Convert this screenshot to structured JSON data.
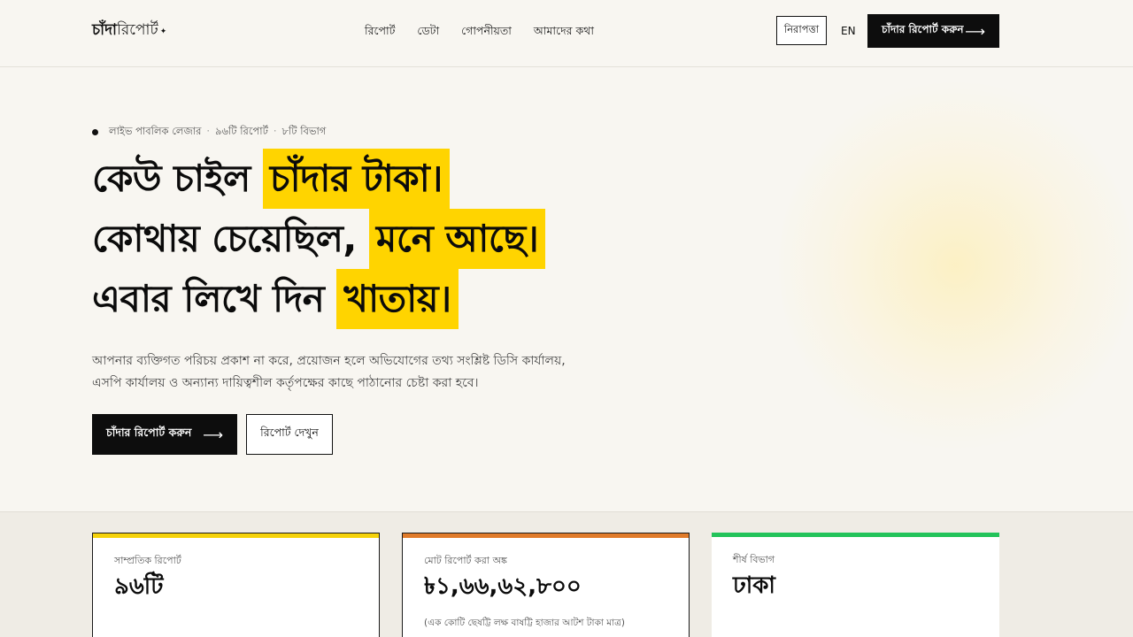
{
  "header": {
    "logo_bold": "চাঁদা",
    "logo_light": "রিপোর্ট",
    "logo_mark": "✦",
    "nav": [
      "রিপোর্ট",
      "ডেটা",
      "গোপনীয়তা",
      "আমাদের কথা"
    ],
    "safety_label": "নিরাপত্তা",
    "lang_label": "EN",
    "cta_label": "চাঁদার রিপোর্ট করুন",
    "cta_arrow": "⟶"
  },
  "hero": {
    "ledger": [
      "লাইভ পাবলিক লেজার",
      "৯৬টি রিপোর্ট",
      "৮টি বিভাগ"
    ],
    "ledger_sep": "·",
    "line1_plain": "কেউ চাইল ",
    "line1_hl": "চাঁদার টাকা।",
    "line2_plain": "কোথায় চেয়েছিল, ",
    "line2_hl": "মনে আছে।",
    "line3_plain": "এবার লিখে দিন ",
    "line3_hl": "খাতায়।",
    "description": "আপনার ব্যক্তিগত পরিচয় প্রকাশ না করে, প্রয়োজন হলে অভিযোগের তথ্য সংশ্লিষ্ট ডিসি কার্যালয়, এসপি কার্যালয় ও অন্যান্য দায়িত্বশীল কর্তৃপক্ষের কাছে পাঠানোর চেষ্টা করা হবে।",
    "primary_label": "চাঁদার রিপোর্ট করুন",
    "primary_arrow": "⟶",
    "secondary_label": "রিপোর্ট দেখুন"
  },
  "stats": [
    {
      "label": "সাম্প্রতিক রিপোর্ট",
      "value": "৯৬টি",
      "note": "",
      "accent": "#f5d20a"
    },
    {
      "label": "মোট রিপোর্ট করা অঙ্ক",
      "value": "৳১,৬৬,৬২,৮০০",
      "note": "(এক কোটি ছেষট্টি লক্ষ বাষট্টি হাজার আটশ টাকা মাত্র)",
      "accent": "#e07b2a"
    },
    {
      "label": "শীর্ষ বিভাগ",
      "value": "ঢাকা",
      "note": "",
      "accent": "#22c35a"
    }
  ],
  "colors": {
    "highlight": "#ffd400",
    "dark": "#0d0d0d",
    "background": "#f8f6f1"
  }
}
